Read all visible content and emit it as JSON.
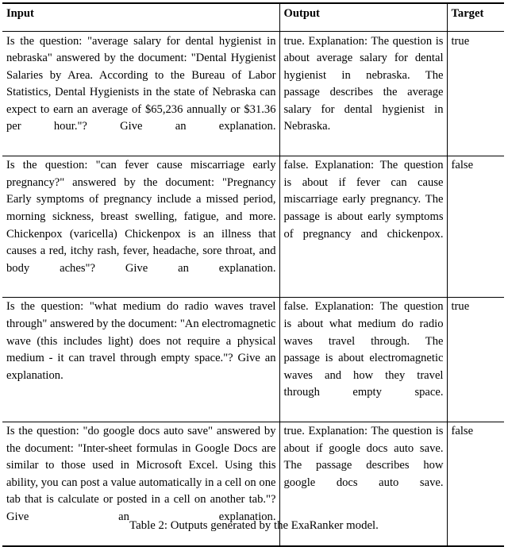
{
  "table": {
    "headers": [
      "Input",
      "Output",
      "Target"
    ],
    "rows": [
      {
        "input": "Is the question: \"average salary for dental hygienist in nebraska\" answered by the document: \"Dental Hygienist Salaries by Area. According to the Bureau of Labor Statistics, Dental Hygienists in the state of Nebraska can expect to earn an average of $65,236 annually or $31.36 per hour.\"? Give an explanation.",
        "output": "true. Explanation: The question is about average salary for dental hygienist in nebraska. The passage describes the average salary for dental hygienist in Nebraska.",
        "target": "true"
      },
      {
        "input": "Is the question: \"can fever cause miscarriage early pregnancy?\" answered by the document: \"Pregnancy Early symptoms of pregnancy include a missed period, morning sickness, breast swelling, fatigue, and more. Chickenpox (varicella) Chickenpox is an illness that causes a red, itchy rash, fever, headache, sore throat, and body aches\"? Give an explanation.",
        "output": "false. Explanation: The question is about if fever can cause miscarriage early pregnancy. The passage is about early symptoms of pregnancy and chickenpox.",
        "target": "false"
      },
      {
        "input": "Is the question: \"what medium do radio waves travel through\" answered by the document: \"An electromagnetic wave (this includes light) does not require a physical medium - it can travel through empty space.\"? Give an explanation.",
        "output": "false. Explanation: The question is about what medium do radio waves travel through. The passage is about electromagnetic waves and how they travel through empty space.",
        "target": "true"
      },
      {
        "input": "Is the question: \"do google docs auto save\" answered by the document: \"Inter-sheet formulas in Google Docs are similar to those used in Microsoft Excel. Using this ability, you can post a value automatically in a cell on one tab that is calculate or posted in a cell on another tab.\"? Give an explanation.",
        "output": "true. Explanation: The question is about if google docs auto save. The passage describes how google docs auto save.",
        "target": "false"
      }
    ]
  },
  "caption": {
    "text": "Table 2: Outputs generated by the ExaRanker model."
  },
  "colors": {
    "text": "#000000",
    "rule": "#000000",
    "background": "#ffffff"
  }
}
